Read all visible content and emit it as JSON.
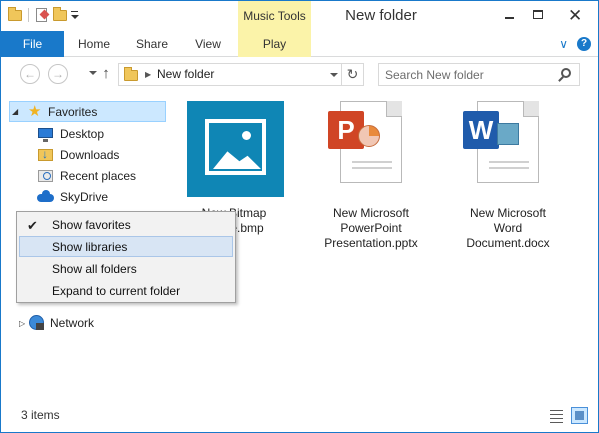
{
  "titlebar": {
    "window_title": "New folder",
    "context_tab_header": "Music Tools",
    "qat_icons": [
      "folder-icon",
      "properties-icon",
      "new-folder-icon",
      "customize-qat-icon"
    ],
    "window_buttons": [
      "minimize",
      "maximize",
      "close"
    ],
    "close_glyph": "✕"
  },
  "ribbon": {
    "tabs": [
      {
        "label": "File",
        "active": true
      },
      {
        "label": "Home"
      },
      {
        "label": "Share"
      },
      {
        "label": "View"
      },
      {
        "label": "Play"
      }
    ],
    "expand_glyph": "∨",
    "help_glyph": "?"
  },
  "navbar": {
    "back_glyph": "←",
    "forward_glyph": "→",
    "up_glyph": "↑",
    "address_separator": "▶",
    "address_path": "New folder",
    "refresh_glyph": "↻",
    "search_placeholder": "Search New folder"
  },
  "navpane": {
    "favorites_label": "Favorites",
    "favorites_expanded_glyph": "◢",
    "items": [
      {
        "label": "Desktop",
        "icon": "desktop-icon"
      },
      {
        "label": "Downloads",
        "icon": "downloads-icon"
      },
      {
        "label": "Recent places",
        "icon": "recent-places-icon"
      },
      {
        "label": "SkyDrive",
        "icon": "skydrive-icon"
      }
    ],
    "network_label": "Network",
    "network_collapsed_glyph": "▷"
  },
  "context_menu": {
    "items": [
      {
        "label": "Show favorites",
        "checked": true
      },
      {
        "label": "Show libraries",
        "highlighted": true
      },
      {
        "label": "Show all folders"
      },
      {
        "label": "Expand to current folder"
      }
    ],
    "check_glyph": "✔"
  },
  "files": [
    {
      "name_lines": [
        "New Bitmap",
        "e.bmp"
      ],
      "type": "bmp",
      "icon": "bitmap-image-icon"
    },
    {
      "name_lines": [
        "New Microsoft",
        "PowerPoint",
        "Presentation.pptx"
      ],
      "type": "pptx",
      "icon": "powerpoint-icon",
      "badge": "P"
    },
    {
      "name_lines": [
        "New Microsoft",
        "Word",
        "Document.docx"
      ],
      "type": "docx",
      "icon": "word-icon",
      "badge": "W"
    }
  ],
  "statusbar": {
    "item_count": "3 items",
    "view_buttons": [
      "details-view",
      "large-icons-view"
    ]
  },
  "colors": {
    "accent": "#1979ca",
    "context_tab": "#fbf3a9",
    "selection": "#cce8ff",
    "menu_highlight": "#d8e5f4"
  }
}
